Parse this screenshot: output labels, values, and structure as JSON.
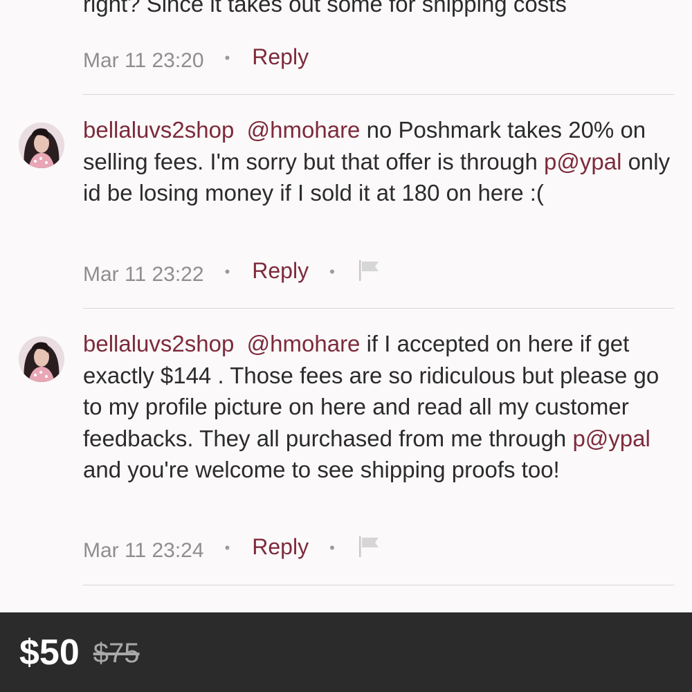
{
  "comments": {
    "top_partial": {
      "text": "right? Since it takes out some for shipping costs",
      "timestamp": "Mar 11 23:20",
      "reply_label": "Reply"
    },
    "items": [
      {
        "username": "bellaluvs2shop",
        "mention": "@hmohare",
        "text_before": " no Poshmark takes 20% on selling fees. I'm sorry but that offer is through ",
        "highlight": "p@ypal",
        "text_after": " only id be losing money if I sold it at 180 on here :(",
        "timestamp": "Mar 11 23:22",
        "reply_label": "Reply",
        "flag_icon": "flag-icon"
      },
      {
        "username": "bellaluvs2shop",
        "mention": "@hmohare",
        "text_before": " if I accepted on here if get exactly $144 . Those fees are so ridiculous but please go to my profile picture on here and read all my customer feedbacks. They all purchased from me through ",
        "highlight": "p@ypal",
        "text_after": " and you're welcome to see shipping proofs too!",
        "timestamp": "Mar 11 23:24",
        "reply_label": "Reply",
        "flag_icon": "flag-icon"
      }
    ]
  },
  "price_bar": {
    "price": "$50",
    "original_price": "$75"
  },
  "colors": {
    "accent": "#7d2a3b",
    "bar_bg": "#2b2b2b",
    "page_bg": "#fbf9fa"
  }
}
